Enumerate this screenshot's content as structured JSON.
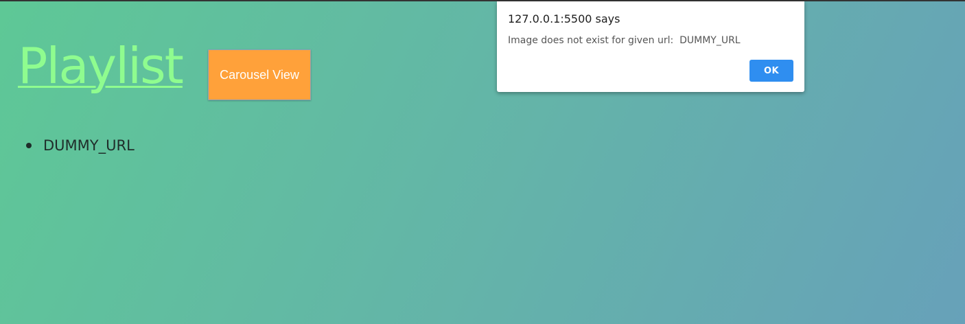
{
  "page": {
    "title": "Playlist",
    "carousel_button_label": "Carousel View",
    "playlist_items": [
      "DUMMY_URL"
    ]
  },
  "alert": {
    "origin": "127.0.0.1:5500 says",
    "message": "Image does not exist for given url:  DUMMY_URL",
    "ok_label": "OK"
  },
  "colors": {
    "background_start": "#5ec896",
    "background_end": "#67a1b9",
    "title": "#8ffc8f",
    "carousel_button": "#ffa13a",
    "ok_button": "#2f8ef0"
  }
}
